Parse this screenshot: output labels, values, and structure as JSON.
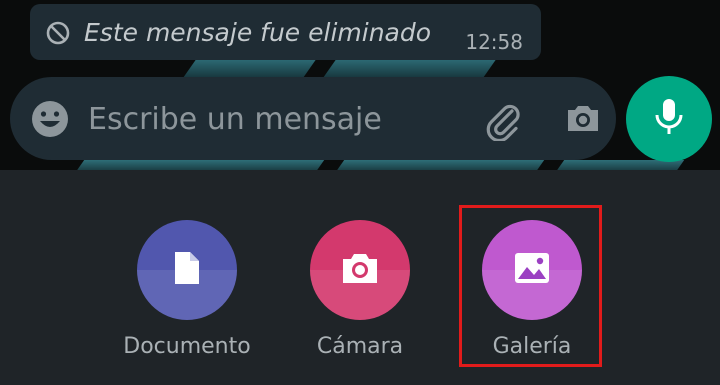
{
  "deleted_message": {
    "text": "Este mensaje fue eliminado",
    "time": "12:58",
    "icon": "ban-icon"
  },
  "compose": {
    "placeholder": "Escribe un mensaje",
    "icons": [
      "emoji-icon",
      "paperclip-icon",
      "camera-icon",
      "microphone-icon"
    ]
  },
  "attachments": [
    {
      "label": "Documento",
      "icon": "document-icon",
      "color": "#5157ae"
    },
    {
      "label": "Cámara",
      "icon": "camera-icon",
      "color": "#d3396d"
    },
    {
      "label": "Galería",
      "icon": "gallery-icon",
      "color": "#bf59cf"
    }
  ],
  "colors": {
    "send_button": "#00a884",
    "bubble": "#1f2c34",
    "sheet": "#1f2428",
    "highlight": "#e11b1b"
  }
}
